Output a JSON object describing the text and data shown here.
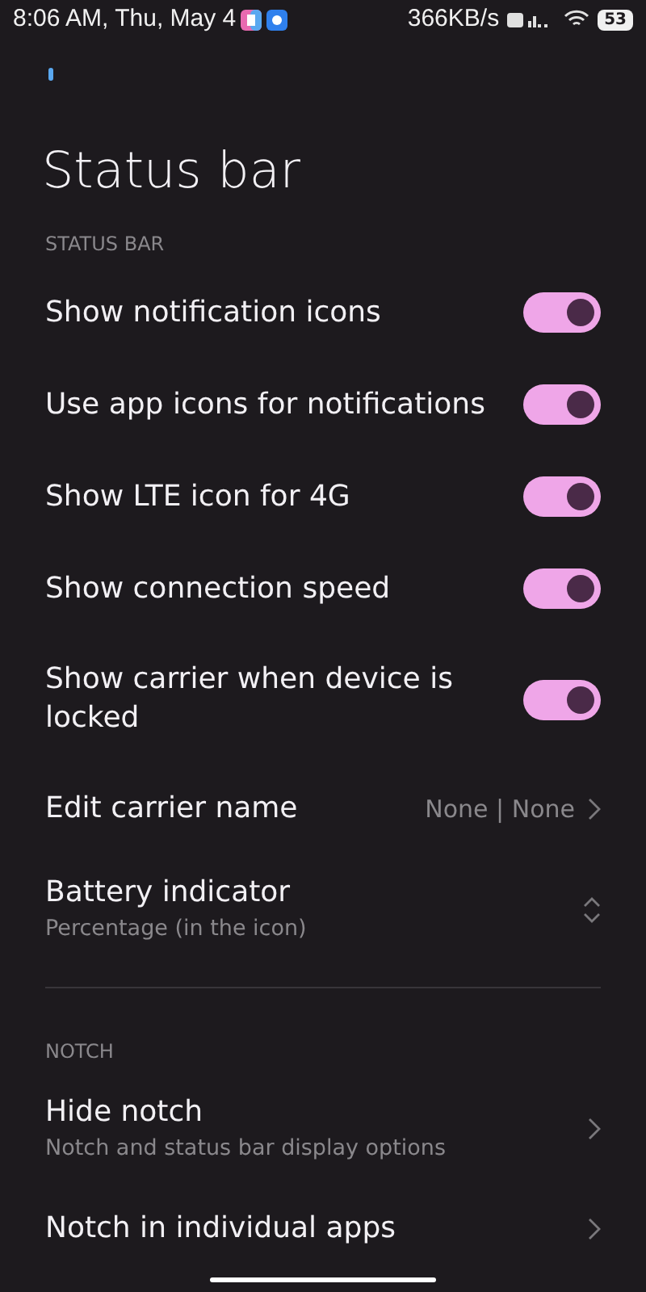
{
  "status_bar": {
    "time": "8:06 AM, Thu, May 4",
    "speed": "366KB/s",
    "battery": "53"
  },
  "title": "Status bar",
  "sections": [
    {
      "header": "STATUS BAR",
      "items": [
        {
          "kind": "toggle",
          "label": "Show notification icons",
          "on": true
        },
        {
          "kind": "toggle",
          "label": "Use app icons for notifications",
          "on": true
        },
        {
          "kind": "toggle",
          "label": "Show LTE icon for 4G",
          "on": true
        },
        {
          "kind": "toggle",
          "label": "Show connection speed",
          "on": true
        },
        {
          "kind": "toggle",
          "label": "Show carrier when device is locked",
          "on": true
        },
        {
          "kind": "link",
          "label": "Edit carrier name",
          "value": "None | None"
        },
        {
          "kind": "select",
          "label": "Battery indicator",
          "summary": "Percentage (in the icon)"
        }
      ]
    },
    {
      "header": "NOTCH",
      "items": [
        {
          "kind": "link",
          "label": "Hide notch",
          "summary": "Notch and status bar display options"
        },
        {
          "kind": "link",
          "label": "Notch in individual apps"
        }
      ]
    }
  ]
}
